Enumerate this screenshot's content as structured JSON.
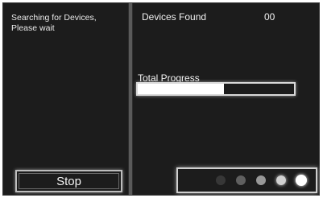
{
  "left_panel": {
    "status_text": "Searching for Devices, Please wait",
    "stop_label": "Stop"
  },
  "right_panel": {
    "devices_found_label": "Devices Found",
    "devices_found_count": "00",
    "total_progress_label": "Total Progress",
    "total_progress_fraction": 0.55
  },
  "activity_indicator": {
    "dot_count": 5,
    "dot_opacities": [
      0.12,
      0.3,
      0.55,
      0.8,
      1.0
    ]
  }
}
